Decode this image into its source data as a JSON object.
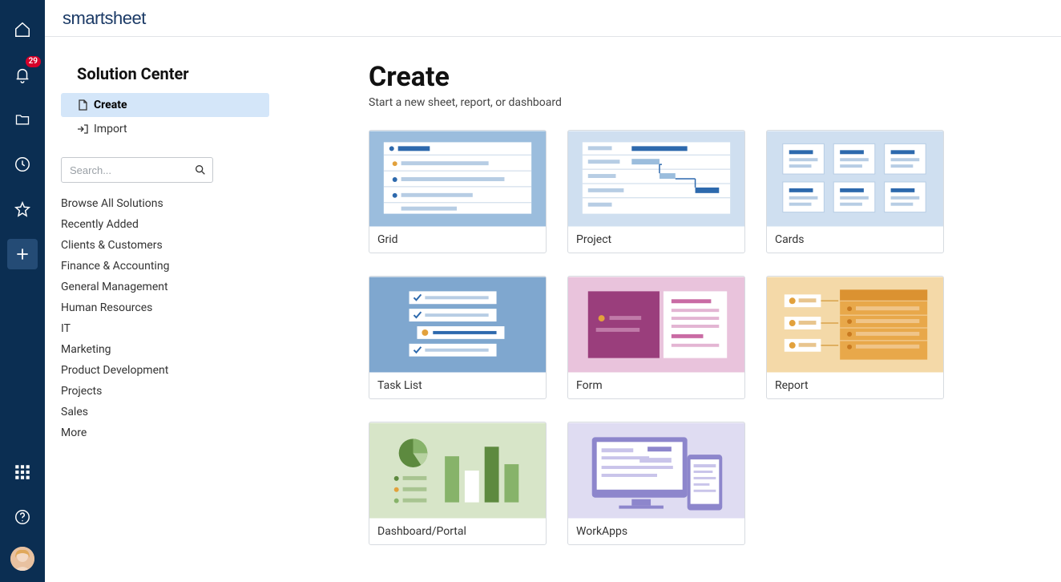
{
  "brand": {
    "name": "smartsheet"
  },
  "rail": {
    "notification_count": "29"
  },
  "sidebar": {
    "title": "Solution Center",
    "nav": {
      "create": "Create",
      "import": "Import"
    },
    "search_placeholder": "Search...",
    "categories": [
      "Browse All Solutions",
      "Recently Added",
      "Clients & Customers",
      "Finance & Accounting",
      "General Management",
      "Human Resources",
      "IT",
      "Marketing",
      "Product Development",
      "Projects",
      "Sales",
      "More"
    ]
  },
  "main": {
    "heading": "Create",
    "subtitle": "Start a new sheet, report, or dashboard",
    "cards": [
      "Grid",
      "Project",
      "Cards",
      "Task List",
      "Form",
      "Report",
      "Dashboard/Portal",
      "WorkApps"
    ]
  }
}
